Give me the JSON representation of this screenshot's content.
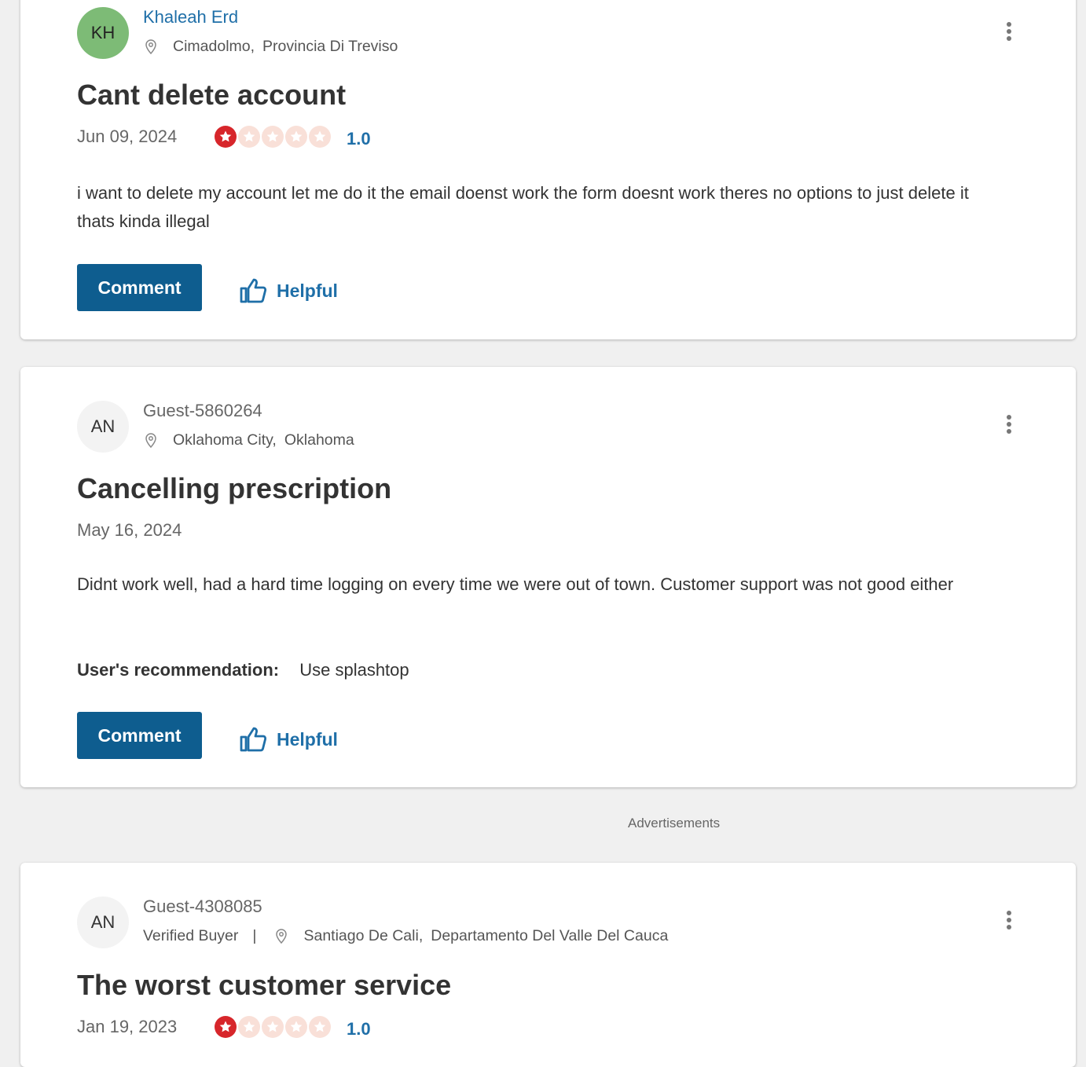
{
  "reviews": [
    {
      "avatar": "KH",
      "avatar_color": "#7dbb76",
      "username": "Khaleah Erd",
      "city": "Cimadolmo,",
      "region": "Provincia Di Treviso",
      "title": "Cant delete account",
      "date": "Jun 09, 2024",
      "rating": "1.0",
      "stars_filled": 1,
      "stars_total": 5,
      "body": "i want to delete my account let me do it the email doenst work the form doesnt work theres no options to just delete it thats kinda illegal",
      "comment_label": "Comment",
      "helpful_label": "Helpful"
    },
    {
      "avatar": "AN",
      "username": "Guest-5860264",
      "city": "Oklahoma City,",
      "region": "Oklahoma",
      "title": "Cancelling prescription",
      "date": "May 16, 2024",
      "body": "Didnt work well, had a hard time logging on every time we were out of town. Customer support was not good either",
      "recommendation_label": "User's recommendation:",
      "recommendation_value": "Use splashtop",
      "comment_label": "Comment",
      "helpful_label": "Helpful"
    },
    {
      "avatar": "AN",
      "username": "Guest-4308085",
      "verified": "Verified Buyer",
      "divider": "|",
      "city": "Santiago De Cali,",
      "region": "Departamento Del Valle Del Cauca",
      "title": "The worst customer service",
      "date": "Jan 19, 2023",
      "rating": "1.0",
      "stars_filled": 1,
      "stars_total": 5
    }
  ],
  "ads_label": "Advertisements",
  "colors": {
    "accent": "#0e5d8f",
    "link": "#1f6fa8",
    "star_filled": "#d7262b",
    "star_empty": "#f9e0d8"
  },
  "icons": [
    "location-pin-icon",
    "more-vertical-icon",
    "star-icon",
    "thumbs-up-icon"
  ]
}
